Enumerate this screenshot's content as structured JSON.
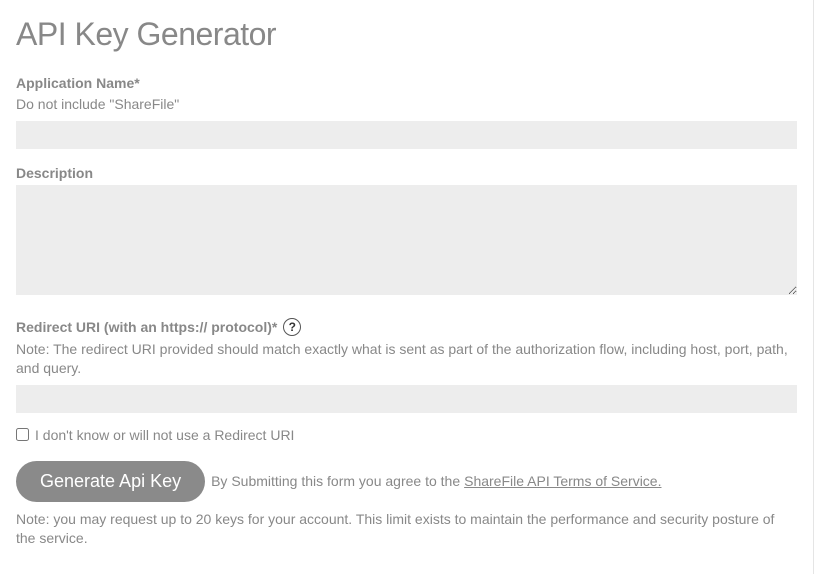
{
  "title": "API Key Generator",
  "appName": {
    "label": "Application Name*",
    "hint": "Do not include \"ShareFile\"",
    "value": ""
  },
  "description": {
    "label": "Description",
    "value": ""
  },
  "redirectUri": {
    "label": "Redirect URI (with an https:// protocol)*",
    "note": "Note: The redirect URI provided should match exactly what is sent as part of the authorization flow, including host, port, path, and query.",
    "value": ""
  },
  "noRedirect": {
    "label": "I don't know or will not use a Redirect URI",
    "checked": false
  },
  "submit": {
    "button": "Generate Api Key",
    "tosPrefix": " By Submitting this form you agree to the ",
    "tosLink": "ShareFile API Terms of Service."
  },
  "footerNote": "Note: you may request up to 20 keys for your account. This limit exists to maintain the performance and security posture of the service."
}
